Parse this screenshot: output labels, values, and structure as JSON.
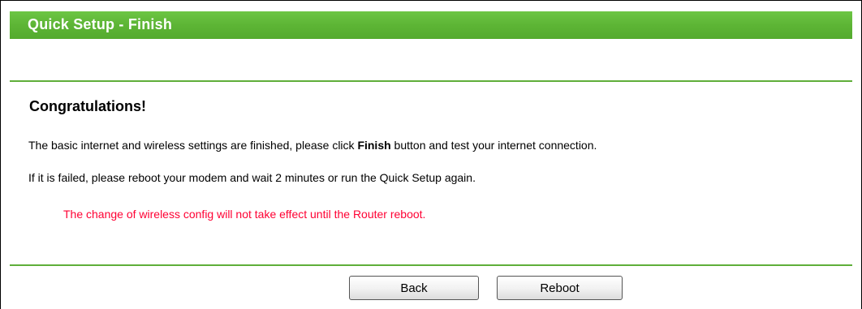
{
  "header": {
    "title": "Quick Setup - Finish"
  },
  "content": {
    "heading": "Congratulations!",
    "line1_before": "The basic internet and wireless settings are finished, please click ",
    "line1_bold": "Finish",
    "line1_after": " button and test your internet connection.",
    "line2": "If it is failed, please reboot your modem and wait 2 minutes or run the Quick Setup again.",
    "warning": "The change of wireless config will not take effect until the Router reboot."
  },
  "buttons": {
    "back_label": "Back",
    "reboot_label": "Reboot"
  },
  "colors": {
    "header_green": "#5db535",
    "divider_green": "#5fae3a",
    "warning_red": "#ff0033"
  }
}
